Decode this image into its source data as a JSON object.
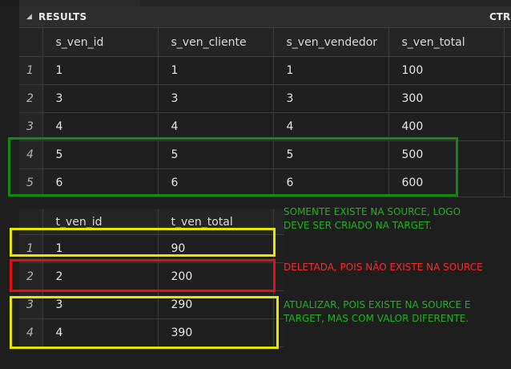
{
  "results_panel": {
    "collapse_glyph": "◢",
    "title": "RESULTS",
    "shortcut": "CTRL+AI"
  },
  "source_table": {
    "columns": [
      "s_ven_id",
      "s_ven_cliente",
      "s_ven_vendedor",
      "s_ven_total"
    ],
    "rows": [
      {
        "n": "1",
        "cells": [
          "1",
          "1",
          "1",
          "100"
        ]
      },
      {
        "n": "2",
        "cells": [
          "3",
          "3",
          "3",
          "300"
        ]
      },
      {
        "n": "3",
        "cells": [
          "4",
          "4",
          "4",
          "400"
        ]
      },
      {
        "n": "4",
        "cells": [
          "5",
          "5",
          "5",
          "500"
        ]
      },
      {
        "n": "5",
        "cells": [
          "6",
          "6",
          "6",
          "600"
        ]
      }
    ]
  },
  "target_table": {
    "columns": [
      "t_ven_id",
      "t_ven_total"
    ],
    "rows": [
      {
        "n": "1",
        "cells": [
          "1",
          "90"
        ]
      },
      {
        "n": "2",
        "cells": [
          "2",
          "200"
        ]
      },
      {
        "n": "3",
        "cells": [
          "3",
          "290"
        ]
      },
      {
        "n": "4",
        "cells": [
          "4",
          "390"
        ]
      }
    ]
  },
  "annotations": {
    "insert_note": [
      "SOMENTE EXISTE NA SOURCE, LOGO",
      "DEVE SER CRIADO NA TARGET."
    ],
    "delete_note": "DELETADA, POIS NÃO EXISTE NA SOURCE",
    "update_note": [
      "ATUALIZAR, POIS EXISTE NA SOURCE E",
      "TARGET, MAS COM VALOR DIFERENTE."
    ]
  },
  "colors": {
    "insert": "#118a11",
    "delete": "#e01010",
    "update": "#e8e600"
  }
}
